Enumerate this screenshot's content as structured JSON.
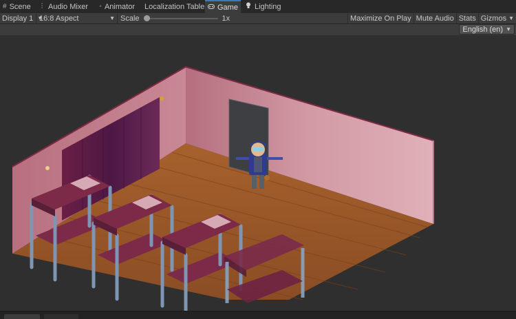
{
  "tabs": [
    {
      "label": "Scene",
      "icon": "grid-icon"
    },
    {
      "label": "Audio Mixer",
      "icon": "mixer-icon"
    },
    {
      "label": "Animator",
      "icon": "animator-icon"
    },
    {
      "label": "Localization Tables",
      "icon": ""
    },
    {
      "label": "Game",
      "icon": "gamepad-icon"
    },
    {
      "label": "Lighting",
      "icon": "lightbulb-icon"
    }
  ],
  "toolbar": {
    "display": "Display 1",
    "aspect": "16:8 Aspect",
    "scale_label": "Scale",
    "scale_value": "1x",
    "maximize": "Maximize On Play",
    "mute": "Mute Audio",
    "stats": "Stats",
    "gizmos": "Gizmos"
  },
  "language": "English (en)",
  "colors": {
    "accent": "#3a79bb",
    "wall": "#c98a99",
    "floor": "#9c5a2c",
    "mattress": "#7d2a49",
    "bed_frame": "#7e96b4"
  }
}
